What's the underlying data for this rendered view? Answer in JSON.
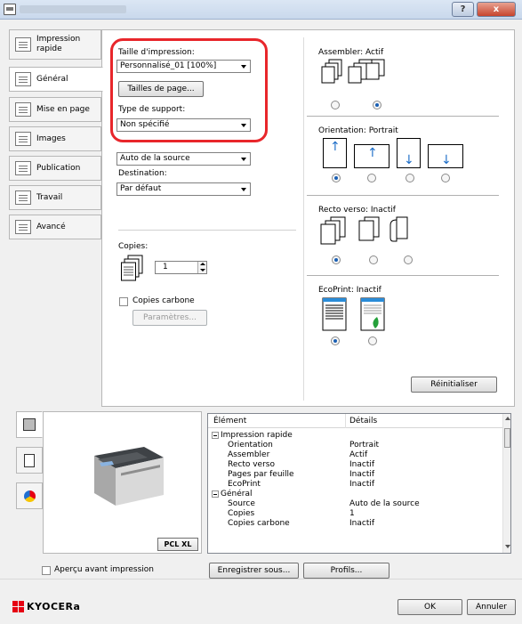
{
  "window": {
    "help_label": "?",
    "close_label": "x"
  },
  "tabs": [
    {
      "label": "Impression rapide",
      "icon": "quick-print-icon"
    },
    {
      "label": "Général",
      "icon": "general-icon"
    },
    {
      "label": "Mise en page",
      "icon": "layout-icon"
    },
    {
      "label": "Images",
      "icon": "images-icon"
    },
    {
      "label": "Publication",
      "icon": "publication-icon"
    },
    {
      "label": "Travail",
      "icon": "job-icon"
    },
    {
      "label": "Avancé",
      "icon": "advanced-icon"
    }
  ],
  "general": {
    "print_size_label": "Taille d'impression:",
    "print_size_value": "Personnalisé_01 [100%]",
    "page_sizes_button": "Tailles de page...",
    "media_type_label": "Type de support:",
    "media_type_value": "Non spécifié",
    "source_value": "Auto de la source",
    "destination_label": "Destination:",
    "destination_value": "Par défaut",
    "copies_label": "Copies:",
    "copies_value": "1",
    "carbon_copies_label": "Copies carbone",
    "settings_button": "Paramètres..."
  },
  "right": {
    "collate_label": "Assembler: Actif",
    "orientation_label": "Orientation: Portrait",
    "duplex_label": "Recto verso: Inactif",
    "ecoprint_label": "EcoPrint: Inactif",
    "reset_button": "Réinitialiser"
  },
  "preview": {
    "badge": "PCL XL"
  },
  "details": {
    "col_element": "Élément",
    "col_details": "Détails",
    "rows": [
      {
        "element": "Impression rapide",
        "detail": "",
        "group": true
      },
      {
        "element": "Orientation",
        "detail": "Portrait",
        "group": false
      },
      {
        "element": "Assembler",
        "detail": "Actif",
        "group": false
      },
      {
        "element": "Recto verso",
        "detail": "Inactif",
        "group": false
      },
      {
        "element": "Pages par feuille",
        "detail": "Inactif",
        "group": false
      },
      {
        "element": "EcoPrint",
        "detail": "Inactif",
        "group": false
      },
      {
        "element": "Général",
        "detail": "",
        "group": true
      },
      {
        "element": "Source",
        "detail": "Auto de la source",
        "group": false
      },
      {
        "element": "Copies",
        "detail": "1",
        "group": false
      },
      {
        "element": "Copies carbone",
        "detail": "Inactif",
        "group": false
      }
    ]
  },
  "bottom": {
    "preview_checkbox_label": "Aperçu avant impression",
    "save_as_button": "Enregistrer sous...",
    "profiles_button": "Profils...",
    "ok_button": "OK",
    "cancel_button": "Annuler",
    "logo_text": "KYOCERa",
    "logo_color": "#e60012"
  }
}
